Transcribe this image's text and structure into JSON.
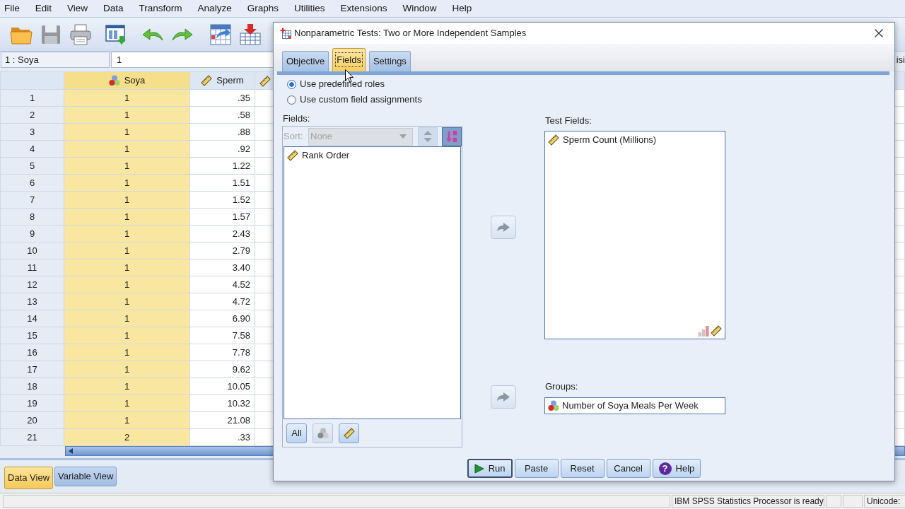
{
  "menu_bar": [
    "File",
    "Edit",
    "View",
    "Data",
    "Transform",
    "Analyze",
    "Graphs",
    "Utilities",
    "Extensions",
    "Window",
    "Help"
  ],
  "toolbar": [
    {
      "kind": "open",
      "disabled": false
    },
    {
      "kind": "save",
      "disabled": true
    },
    {
      "kind": "print",
      "disabled": false
    },
    {
      "kind": "recall",
      "disabled": false
    },
    {
      "kind": "undo",
      "disabled": false
    },
    {
      "kind": "redo",
      "disabled": false
    },
    {
      "kind": "goto",
      "disabled": false
    },
    {
      "kind": "insert",
      "disabled": false
    }
  ],
  "cell_editor": {
    "cell": "1 : Soya",
    "value": "1"
  },
  "variables_indicator": "isi",
  "data_grid": {
    "columns": [
      {
        "name": "Soya",
        "kind": "nominal",
        "selected": true
      },
      {
        "name": "Sperm",
        "kind": "scale",
        "selected": false
      },
      {
        "kind": "scale",
        "selected": false
      }
    ],
    "rows": [
      {
        "number": "1",
        "cells": [
          "1",
          ".35"
        ]
      },
      {
        "number": "2",
        "cells": [
          "1",
          ".58"
        ]
      },
      {
        "number": "3",
        "cells": [
          "1",
          ".88"
        ]
      },
      {
        "number": "4",
        "cells": [
          "1",
          ".92"
        ]
      },
      {
        "number": "5",
        "cells": [
          "1",
          "1.22"
        ]
      },
      {
        "number": "6",
        "cells": [
          "1",
          "1.51"
        ]
      },
      {
        "number": "7",
        "cells": [
          "1",
          "1.52"
        ]
      },
      {
        "number": "8",
        "cells": [
          "1",
          "1.57"
        ]
      },
      {
        "number": "9",
        "cells": [
          "1",
          "2.43"
        ]
      },
      {
        "number": "10",
        "cells": [
          "1",
          "2.79"
        ]
      },
      {
        "number": "11",
        "cells": [
          "1",
          "3.40"
        ]
      },
      {
        "number": "12",
        "cells": [
          "1",
          "4.52"
        ]
      },
      {
        "number": "13",
        "cells": [
          "1",
          "4.72"
        ]
      },
      {
        "number": "14",
        "cells": [
          "1",
          "6.90"
        ]
      },
      {
        "number": "15",
        "cells": [
          "1",
          "7.58"
        ]
      },
      {
        "number": "16",
        "cells": [
          "1",
          "7.78"
        ]
      },
      {
        "number": "17",
        "cells": [
          "1",
          "9.62"
        ]
      },
      {
        "number": "18",
        "cells": [
          "1",
          "10.05"
        ]
      },
      {
        "number": "19",
        "cells": [
          "1",
          "10.32"
        ]
      },
      {
        "number": "20",
        "cells": [
          "1",
          "21.08"
        ]
      },
      {
        "number": "21",
        "cells": [
          "2",
          ".33"
        ]
      }
    ]
  },
  "view_tabs": [
    {
      "label": "Data View",
      "selected": true
    },
    {
      "label": "Variable View",
      "selected": false
    }
  ],
  "status_bar": {
    "message": "IBM SPSS Statistics Processor is ready",
    "encoding": "Unicode:"
  },
  "dialog": {
    "title": "Nonparametric Tests: Two or More Independent Samples",
    "tabs": [
      {
        "label": "Objective",
        "selected": false
      },
      {
        "label": "Fields",
        "selected": true
      },
      {
        "label": "Settings",
        "selected": false
      }
    ],
    "field_roles": [
      {
        "label": "Use predefined roles",
        "selected": true
      },
      {
        "label": "Use custom field assignments",
        "selected": false
      }
    ],
    "fields": {
      "label": "Fields:",
      "sort": {
        "label": "Sort:",
        "value": "None",
        "disabled": true
      },
      "items": [
        {
          "label": "Rank Order",
          "kind": "scale"
        }
      ],
      "filters": [
        {
          "kind": "all",
          "label": "All",
          "disabled": false
        },
        {
          "kind": "nominal",
          "disabled": true
        },
        {
          "kind": "scale",
          "disabled": false
        }
      ]
    },
    "test_fields": {
      "label": "Test Fields:",
      "items": [
        {
          "label": "Sperm Count (Millions)",
          "kind": "scale"
        }
      ],
      "allowed_measures": [
        {
          "kind": "ordinal"
        },
        {
          "kind": "scale"
        }
      ]
    },
    "groups": {
      "label": "Groups:",
      "items": [
        {
          "label": "Number of Soya Meals Per Week",
          "kind": "nominal"
        }
      ]
    },
    "buttons": [
      {
        "kind": "run",
        "label": "Run",
        "default": true
      },
      {
        "kind": "paste",
        "label": "Paste",
        "default": false
      },
      {
        "kind": "reset",
        "label": "Reset",
        "default": false
      },
      {
        "kind": "cancel",
        "label": "Cancel",
        "default": false
      },
      {
        "kind": "help",
        "label": "Help",
        "default": false,
        "icon_glyph": "?"
      }
    ]
  }
}
